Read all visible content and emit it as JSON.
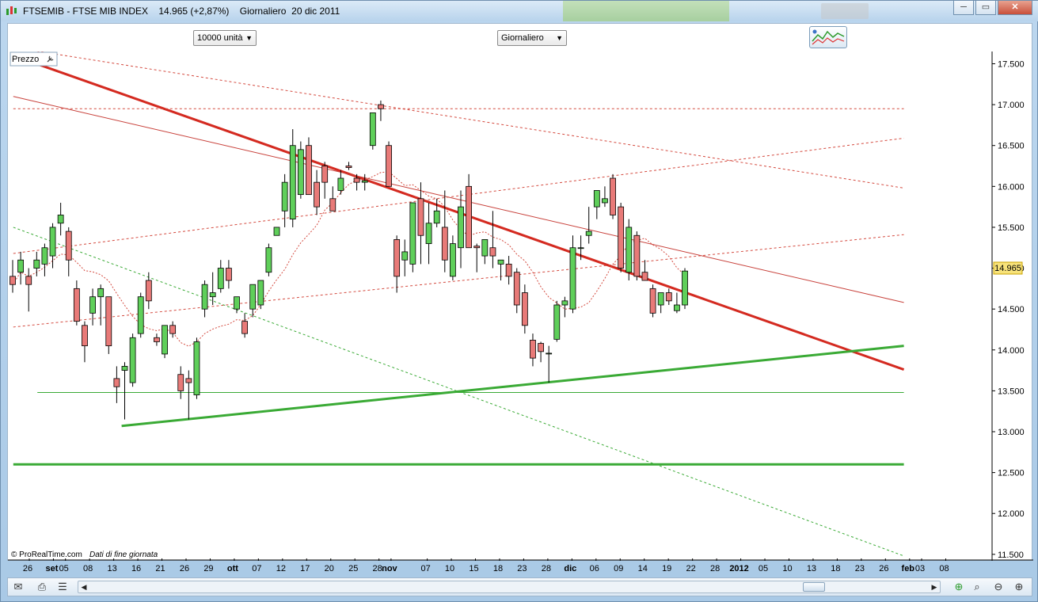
{
  "window": {
    "title": "FTSEMIB - FTSE MIB INDEX",
    "last_price": "14.965 (+2,87%)",
    "period": "Giornaliero",
    "date": "20 dic 2011",
    "min_label": "─",
    "restore_label": "▭",
    "close_label": "✕"
  },
  "toolbar": {
    "units_select": "10000 unità",
    "timeframe_select": "Giornaliero",
    "dropdown_arrow": "▼"
  },
  "panel": {
    "label": "Prezzo",
    "source": "© ProRealTime.com",
    "source_note": "Dati di fine giornata",
    "current_price_badge": "14.965"
  },
  "chart_data": {
    "type": "candlestick",
    "instrument": "FTSE MIB INDEX",
    "period": "Giornaliero",
    "y_axis": {
      "range": [
        11450,
        17650
      ],
      "ticks": [
        "17.500",
        "17.000",
        "16.500",
        "16.000",
        "15.500",
        "15.000",
        "14.500",
        "14.000",
        "13.500",
        "13.000",
        "12.500",
        "12.000",
        "11.500"
      ],
      "position": "right"
    },
    "x_axis": {
      "labels": [
        {
          "t": "26",
          "slot": 0,
          "bold": false
        },
        {
          "t": "set",
          "slot": 2,
          "bold": true
        },
        {
          "t": "05",
          "slot": 3,
          "bold": false
        },
        {
          "t": "08",
          "slot": 5,
          "bold": false
        },
        {
          "t": "13",
          "slot": 7,
          "bold": false
        },
        {
          "t": "16",
          "slot": 9,
          "bold": false
        },
        {
          "t": "21",
          "slot": 11,
          "bold": false
        },
        {
          "t": "26",
          "slot": 13,
          "bold": false
        },
        {
          "t": "29",
          "slot": 15,
          "bold": false
        },
        {
          "t": "ott",
          "slot": 17,
          "bold": true
        },
        {
          "t": "07",
          "slot": 19,
          "bold": false
        },
        {
          "t": "12",
          "slot": 21,
          "bold": false
        },
        {
          "t": "17",
          "slot": 23,
          "bold": false
        },
        {
          "t": "20",
          "slot": 25,
          "bold": false
        },
        {
          "t": "25",
          "slot": 27,
          "bold": false
        },
        {
          "t": "28",
          "slot": 29,
          "bold": false
        },
        {
          "t": "nov",
          "slot": 30,
          "bold": true
        },
        {
          "t": "07",
          "slot": 33,
          "bold": false
        },
        {
          "t": "10",
          "slot": 35,
          "bold": false
        },
        {
          "t": "15",
          "slot": 37,
          "bold": false
        },
        {
          "t": "18",
          "slot": 39,
          "bold": false
        },
        {
          "t": "23",
          "slot": 41,
          "bold": false
        },
        {
          "t": "28",
          "slot": 43,
          "bold": false
        },
        {
          "t": "dic",
          "slot": 45,
          "bold": true
        },
        {
          "t": "06",
          "slot": 47,
          "bold": false
        },
        {
          "t": "09",
          "slot": 49,
          "bold": false
        },
        {
          "t": "14",
          "slot": 51,
          "bold": false
        },
        {
          "t": "19",
          "slot": 53,
          "bold": false
        },
        {
          "t": "22",
          "slot": 55,
          "bold": false
        },
        {
          "t": "28",
          "slot": 57,
          "bold": false
        },
        {
          "t": "2012",
          "slot": 59,
          "bold": true
        },
        {
          "t": "05",
          "slot": 61,
          "bold": false
        },
        {
          "t": "10",
          "slot": 63,
          "bold": false
        },
        {
          "t": "13",
          "slot": 65,
          "bold": false
        },
        {
          "t": "18",
          "slot": 67,
          "bold": false
        },
        {
          "t": "23",
          "slot": 69,
          "bold": false
        },
        {
          "t": "26",
          "slot": 71,
          "bold": false
        },
        {
          "t": "feb",
          "slot": 73,
          "bold": true
        },
        {
          "t": "03",
          "slot": 74,
          "bold": false
        },
        {
          "t": "08",
          "slot": 76,
          "bold": false
        }
      ]
    },
    "candles": [
      {
        "o": 14900,
        "h": 15100,
        "l": 14700,
        "c": 14800
      },
      {
        "o": 14950,
        "h": 15200,
        "l": 14800,
        "c": 15100
      },
      {
        "o": 14900,
        "h": 15000,
        "l": 14470,
        "c": 14800
      },
      {
        "o": 15000,
        "h": 15200,
        "l": 14900,
        "c": 15100
      },
      {
        "o": 15050,
        "h": 15300,
        "l": 14900,
        "c": 15250
      },
      {
        "o": 15150,
        "h": 15550,
        "l": 15000,
        "c": 15500
      },
      {
        "o": 15550,
        "h": 15800,
        "l": 15400,
        "c": 15650
      },
      {
        "o": 15450,
        "h": 15500,
        "l": 14900,
        "c": 15100
      },
      {
        "o": 14750,
        "h": 14850,
        "l": 14300,
        "c": 14350
      },
      {
        "o": 14300,
        "h": 14350,
        "l": 13850,
        "c": 14050
      },
      {
        "o": 14450,
        "h": 14750,
        "l": 14300,
        "c": 14650
      },
      {
        "o": 14650,
        "h": 14800,
        "l": 14300,
        "c": 14750
      },
      {
        "o": 14650,
        "h": 14650,
        "l": 13950,
        "c": 14050
      },
      {
        "o": 13650,
        "h": 13800,
        "l": 13350,
        "c": 13550
      },
      {
        "o": 13750,
        "h": 13850,
        "l": 13150,
        "c": 13800
      },
      {
        "o": 13600,
        "h": 14200,
        "l": 13550,
        "c": 14150
      },
      {
        "o": 14200,
        "h": 14700,
        "l": 14150,
        "c": 14650
      },
      {
        "o": 14850,
        "h": 14950,
        "l": 14500,
        "c": 14600
      },
      {
        "o": 14150,
        "h": 14200,
        "l": 14050,
        "c": 14100
      },
      {
        "o": 13950,
        "h": 14300,
        "l": 13900,
        "c": 14300
      },
      {
        "o": 14300,
        "h": 14350,
        "l": 14150,
        "c": 14200
      },
      {
        "o": 13700,
        "h": 13800,
        "l": 13400,
        "c": 13500
      },
      {
        "o": 13650,
        "h": 13750,
        "l": 13150,
        "c": 13600
      },
      {
        "o": 13450,
        "h": 14150,
        "l": 13400,
        "c": 14100
      },
      {
        "o": 14500,
        "h": 14850,
        "l": 14400,
        "c": 14800
      },
      {
        "o": 14650,
        "h": 14950,
        "l": 14550,
        "c": 14700
      },
      {
        "o": 14750,
        "h": 15100,
        "l": 14700,
        "c": 15000
      },
      {
        "o": 15000,
        "h": 15100,
        "l": 14750,
        "c": 14850
      },
      {
        "o": 14500,
        "h": 14650,
        "l": 14450,
        "c": 14650
      },
      {
        "o": 14350,
        "h": 14450,
        "l": 14150,
        "c": 14200
      },
      {
        "o": 14500,
        "h": 14700,
        "l": 14400,
        "c": 14800
      },
      {
        "o": 14550,
        "h": 14850,
        "l": 14500,
        "c": 14850
      },
      {
        "o": 14950,
        "h": 15300,
        "l": 14900,
        "c": 15250
      },
      {
        "o": 15400,
        "h": 15500,
        "l": 15400,
        "c": 15500
      },
      {
        "o": 15700,
        "h": 16150,
        "l": 15500,
        "c": 16050
      },
      {
        "o": 15600,
        "h": 16700,
        "l": 15500,
        "c": 16500
      },
      {
        "o": 15900,
        "h": 16550,
        "l": 15850,
        "c": 16450
      },
      {
        "o": 16500,
        "h": 16600,
        "l": 15900,
        "c": 15900
      },
      {
        "o": 16050,
        "h": 16200,
        "l": 15650,
        "c": 15750
      },
      {
        "o": 16250,
        "h": 16300,
        "l": 15850,
        "c": 16050
      },
      {
        "o": 15850,
        "h": 16000,
        "l": 15700,
        "c": 15700
      },
      {
        "o": 15950,
        "h": 16200,
        "l": 15900,
        "c": 16100
      },
      {
        "o": 16250,
        "h": 16300,
        "l": 16200,
        "c": 16230
      },
      {
        "o": 16100,
        "h": 16150,
        "l": 15950,
        "c": 16050
      },
      {
        "o": 16050,
        "h": 16150,
        "l": 15950,
        "c": 16070
      },
      {
        "o": 16500,
        "h": 16600,
        "l": 16450,
        "c": 16900
      },
      {
        "o": 17000,
        "h": 17050,
        "l": 16800,
        "c": 16950
      },
      {
        "o": 16500,
        "h": 16550,
        "l": 16000,
        "c": 16000
      },
      {
        "o": 15350,
        "h": 15400,
        "l": 14700,
        "c": 14900
      },
      {
        "o": 15100,
        "h": 15350,
        "l": 14900,
        "c": 15200
      },
      {
        "o": 15050,
        "h": 15800,
        "l": 14950,
        "c": 15800
      },
      {
        "o": 15850,
        "h": 16050,
        "l": 15050,
        "c": 15400
      },
      {
        "o": 15300,
        "h": 15800,
        "l": 15050,
        "c": 15550
      },
      {
        "o": 15550,
        "h": 15850,
        "l": 15500,
        "c": 15700
      },
      {
        "o": 15500,
        "h": 15950,
        "l": 14950,
        "c": 15100
      },
      {
        "o": 14900,
        "h": 15400,
        "l": 14850,
        "c": 15300
      },
      {
        "o": 15250,
        "h": 15950,
        "l": 15000,
        "c": 15750
      },
      {
        "o": 16000,
        "h": 16150,
        "l": 15400,
        "c": 15250
      },
      {
        "o": 15270,
        "h": 15300,
        "l": 14950,
        "c": 15250
      },
      {
        "o": 15150,
        "h": 15300,
        "l": 15050,
        "c": 15350
      },
      {
        "o": 15250,
        "h": 15700,
        "l": 15000,
        "c": 15150
      },
      {
        "o": 15050,
        "h": 15100,
        "l": 14850,
        "c": 15100
      },
      {
        "o": 15050,
        "h": 15150,
        "l": 14800,
        "c": 14900
      },
      {
        "o": 14950,
        "h": 15000,
        "l": 14450,
        "c": 14550
      },
      {
        "o": 14700,
        "h": 14800,
        "l": 14200,
        "c": 14300
      },
      {
        "o": 14120,
        "h": 14200,
        "l": 13800,
        "c": 13900
      },
      {
        "o": 14080,
        "h": 14100,
        "l": 13850,
        "c": 13980
      },
      {
        "o": 13960,
        "h": 14050,
        "l": 13600,
        "c": 13960
      },
      {
        "o": 14130,
        "h": 14600,
        "l": 14100,
        "c": 14550
      },
      {
        "o": 14550,
        "h": 14650,
        "l": 14400,
        "c": 14600
      },
      {
        "o": 14500,
        "h": 15400,
        "l": 14450,
        "c": 15250
      },
      {
        "o": 15250,
        "h": 15400,
        "l": 15100,
        "c": 15250
      },
      {
        "o": 15400,
        "h": 15750,
        "l": 15300,
        "c": 15450
      },
      {
        "o": 15750,
        "h": 15950,
        "l": 15600,
        "c": 15950
      },
      {
        "o": 15800,
        "h": 16000,
        "l": 15750,
        "c": 15850
      },
      {
        "o": 16100,
        "h": 16150,
        "l": 15600,
        "c": 15650
      },
      {
        "o": 15750,
        "h": 15800,
        "l": 14950,
        "c": 15000
      },
      {
        "o": 14950,
        "h": 15600,
        "l": 14850,
        "c": 15500
      },
      {
        "o": 15400,
        "h": 15450,
        "l": 14850,
        "c": 14900
      },
      {
        "o": 14950,
        "h": 15100,
        "l": 14850,
        "c": 14850
      },
      {
        "o": 14750,
        "h": 14800,
        "l": 14400,
        "c": 14450
      },
      {
        "o": 14550,
        "h": 14700,
        "l": 14450,
        "c": 14700
      },
      {
        "o": 14700,
        "h": 14750,
        "l": 14550,
        "c": 14600
      },
      {
        "o": 14480,
        "h": 14700,
        "l": 14450,
        "c": 14550
      },
      {
        "o": 14550,
        "h": 15000,
        "l": 14500,
        "c": 14965
      }
    ],
    "trendlines": [
      {
        "name": "",
        "color": "#d42a20",
        "width": 3,
        "style": "solid",
        "p1": [
          -1,
          17600
        ],
        "p2": [
          73,
          13760
        ]
      },
      {
        "name": "",
        "color": "#c8413b",
        "width": 1,
        "style": "solid",
        "p1": [
          -1,
          17100
        ],
        "p2": [
          73,
          14580
        ]
      },
      {
        "name": "",
        "color": "#d44a3f",
        "width": 1,
        "style": "dashed",
        "p1": [
          -1,
          17700
        ],
        "p2": [
          73,
          15980
        ]
      },
      {
        "name": "",
        "color": "#d44a3f",
        "width": 1,
        "style": "dashed",
        "p1": [
          -1,
          16950
        ],
        "p2": [
          73,
          16950
        ]
      },
      {
        "name": "",
        "color": "#d44a3f",
        "width": 1,
        "style": "dashed",
        "p1": [
          -1,
          14280
        ],
        "p2": [
          73,
          15410
        ]
      },
      {
        "name": "",
        "color": "#d44a3f",
        "width": 1,
        "style": "dashed",
        "p1": [
          -1,
          15180
        ],
        "p2": [
          73,
          16590
        ]
      },
      {
        "name": "",
        "color": "#3aaa35",
        "width": 3,
        "style": "solid",
        "p1": [
          8,
          13070
        ],
        "p2": [
          73,
          14050
        ]
      },
      {
        "name": "",
        "color": "#3aaa35",
        "width": 3,
        "style": "solid",
        "p1": [
          -1,
          12600
        ],
        "p2": [
          73,
          12600
        ]
      },
      {
        "name": "",
        "color": "#3aaa35",
        "width": 1,
        "style": "solid",
        "p1": [
          1,
          13480
        ],
        "p2": [
          73,
          13480
        ]
      },
      {
        "name": "",
        "color": "#3aaa35",
        "width": 1,
        "style": "dashed",
        "p1": [
          -1,
          15500
        ],
        "p2": [
          73,
          11480
        ]
      }
    ],
    "legend": "none",
    "grid": false
  }
}
